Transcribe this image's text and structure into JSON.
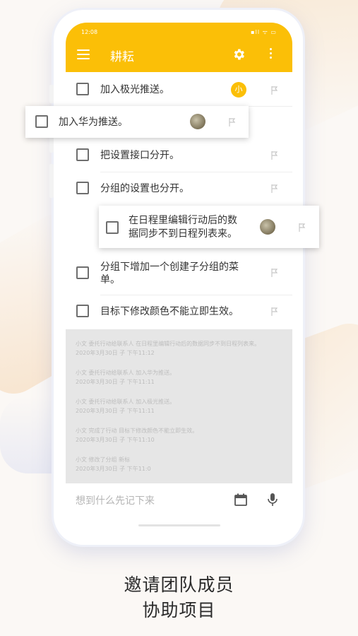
{
  "status": {
    "time": "12:08",
    "icons": "▪ll ᯤ ▭"
  },
  "app": {
    "title": "耕耘"
  },
  "tasks": [
    {
      "label": "加入极光推送。",
      "badge": "小"
    },
    {
      "label": "加入华为推送。"
    },
    {
      "label": "把设置接口分开。"
    },
    {
      "label": "分组的设置也分开。"
    },
    {
      "label": "在日程里编辑行动后的数据同步不到日程列表来。"
    },
    {
      "label": "分组下增加一个创建子分组的菜单。"
    },
    {
      "label": "目标下修改颜色不能立即生效。"
    }
  ],
  "task_lines": {
    "t4a": "在日程里编辑行动后的数",
    "t4b": "据同步不到日程列表来。",
    "t5a": "分组下增加一个创建子分组的菜",
    "t5b": "单。"
  },
  "logs": [
    {
      "text": "小文 委托行动给联系人 在日程里编辑行动后的数据同步不到日程列表来。",
      "time": "2020年3月30日 子 下午11:12"
    },
    {
      "text": "小文 委托行动给联系人 加入华为推送。",
      "time": "2020年3月30日 子 下午11:11"
    },
    {
      "text": "小文 委托行动给联系人 加入极光推送。",
      "time": "2020年3月30日 子 下午11:11"
    },
    {
      "text": "小文 完成了行动 目标下修改颜色不能立即生效。",
      "time": "2020年3月30日 子 下午11:10"
    },
    {
      "text": "小文 修改了分组 新标",
      "time": "2020年3月30日 子 下午11:0"
    }
  ],
  "input": {
    "placeholder": "想到什么先记下来"
  },
  "caption": {
    "line1": "邀请团队成员",
    "line2": "协助项目"
  },
  "colors": {
    "accent": "#fbbf07",
    "background": "#fbf8f5"
  }
}
